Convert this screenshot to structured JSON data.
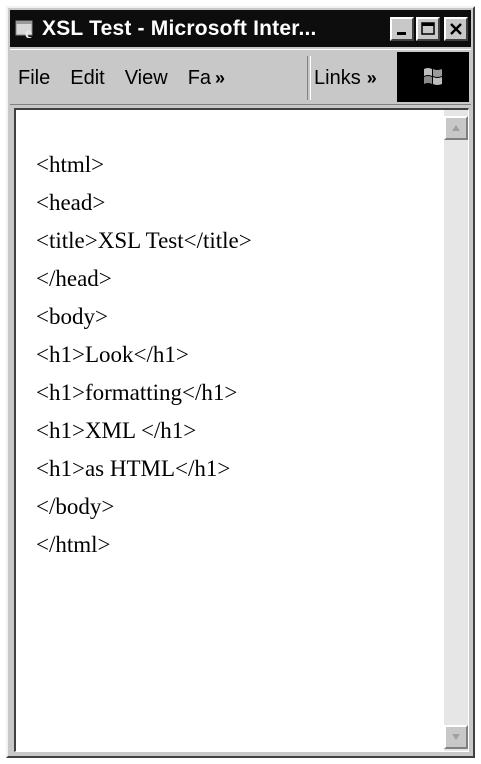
{
  "window": {
    "title": "XSL Test - Microsoft Inter...",
    "icon": "ie-icon",
    "controls": [
      "minimize-icon",
      "maximize-icon",
      "close-icon"
    ]
  },
  "menubar": {
    "items": [
      {
        "label": "File"
      },
      {
        "label": "Edit"
      },
      {
        "label": "View"
      },
      {
        "label": "Fa"
      }
    ],
    "more_glyph": "»",
    "links_label": "Links",
    "links_more_glyph": "»",
    "throbber_icon": "windows-logo-icon"
  },
  "document": {
    "lines": [
      "<html>",
      "<head>",
      "<title>XSL Test</title>",
      "</head>",
      "<body>",
      "<h1>Look</h1>",
      "<h1>formatting</h1>",
      "<h1>XML </h1>",
      "<h1>as HTML</h1>",
      "</body>",
      "</html>"
    ]
  },
  "colors": {
    "titlebar": "#0d0d0d",
    "chrome": "#c8c8c8",
    "content_bg": "#ffffff"
  }
}
